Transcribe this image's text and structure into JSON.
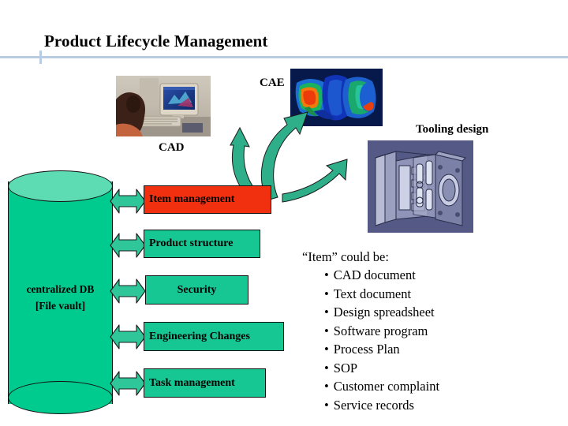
{
  "slide": {
    "title": "Product Lifecycle Management",
    "background_color": "#ffffff",
    "rule_color": "#b8cde4"
  },
  "labels": {
    "cad": "CAD",
    "cae": "CAE",
    "tooling": "Tooling design"
  },
  "images": {
    "cad_photo_alt": "cad-workstation-photo",
    "cae_image_alt": "cae-fea-result-image",
    "tooling_image_alt": "tooling-mold-cad-render"
  },
  "database": {
    "line1": "centralized DB",
    "line2": "[File vault]",
    "fill_color": "#00cb8e",
    "top_color": "#5ddcb4"
  },
  "modules": [
    {
      "label": "Item management",
      "color": "#f0300f"
    },
    {
      "label": "Product structure",
      "color": "#17c793"
    },
    {
      "label": "Security",
      "color": "#17c793"
    },
    {
      "label": "Engineering Changes",
      "color": "#17c793"
    },
    {
      "label": "Task management",
      "color": "#17c793"
    }
  ],
  "item_panel": {
    "heading": "“Item” could be:",
    "bullet_char": "•",
    "items": [
      "CAD document",
      "Text document",
      "Design spreadsheet",
      "Software program",
      "Process Plan",
      "SOP",
      "Customer complaint",
      "Service records"
    ]
  }
}
